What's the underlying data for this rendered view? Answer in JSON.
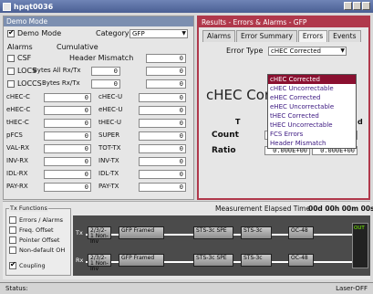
{
  "window": {
    "title": "hpqt0036"
  },
  "demo_panel": {
    "header": "Demo Mode",
    "demo_mode_label": "Demo Mode",
    "category_label": "Category",
    "category_value": "GFP",
    "alarms_label": "Alarms",
    "cumulative_label": "Cumulative",
    "alarm_rows": [
      {
        "label": "CSF",
        "desc": "Header Mismatch",
        "value": "0"
      },
      {
        "label": "LOCS",
        "desc": "Bytes All Rx/Tx",
        "value": "0",
        "value2": "0"
      },
      {
        "label": "LOCCS",
        "desc": "Bytes Rx/Tx",
        "value": "0",
        "value2": "0"
      }
    ],
    "counters_left": [
      {
        "label": "cHEC-C",
        "value": "0"
      },
      {
        "label": "eHEC-C",
        "value": "0"
      },
      {
        "label": "tHEC-C",
        "value": "0"
      },
      {
        "label": "pFCS",
        "value": "0"
      },
      {
        "label": "VAL-RX",
        "value": "0"
      },
      {
        "label": "INV-RX",
        "value": "0"
      },
      {
        "label": "IDL-RX",
        "value": "0"
      },
      {
        "label": "PAY-RX",
        "value": "0"
      }
    ],
    "counters_right": [
      {
        "label": "cHEC-U",
        "value": "0"
      },
      {
        "label": "eHEC-U",
        "value": "0"
      },
      {
        "label": "tHEC-U",
        "value": "0"
      },
      {
        "label": "SUPER",
        "value": "0"
      },
      {
        "label": "TOT-TX",
        "value": "0"
      },
      {
        "label": "INV-TX",
        "value": "0"
      },
      {
        "label": "IDL-TX",
        "value": "0"
      },
      {
        "label": "PAY-TX",
        "value": "0"
      }
    ]
  },
  "results_panel": {
    "header": "Results - Errors & Alarms - GFP",
    "tabs": [
      "Alarms",
      "Error Summary",
      "Errors",
      "Events"
    ],
    "error_type_label": "Error Type",
    "error_type_value": "cHEC Corrected",
    "big_title": "cHEC Cor",
    "column_hint_left": "T",
    "column_hint_right": "d",
    "count_label": "Count",
    "ratio_label": "Ratio",
    "ratio_value_1": "0.000E+00",
    "ratio_value_2": "0.000E+00",
    "dropdown_options": [
      "cHEC Corrected",
      "cHEC Uncorrectable",
      "eHEC Corrected",
      "eHEC Uncorrectable",
      "tHEC Corrected",
      "tHEC Uncorrectable",
      "FCS Errors",
      "Header Mismatch"
    ],
    "dropdown_selected_index": 0
  },
  "tx_functions": {
    "title": "Tx Functions",
    "items": [
      "Errors / Alarms",
      "Freq. Offset",
      "Pointer Offset",
      "Non-default OH"
    ],
    "coupling_label": "Coupling"
  },
  "diagram": {
    "elapsed_label": "Measurement Elapsed Time",
    "elapsed_value": "00d 00h 00m 00s",
    "tx_label": "Tx",
    "rx_label": "Rx",
    "tx_blocks": [
      "2/3/2-1 Non-Inv",
      "GFP Framed",
      "STS-3c SPE",
      "STS-3c",
      "OC-48"
    ],
    "rx_blocks": [
      "2/3/2-1 Non-Inv",
      "GFP Framed",
      "STS-3c SPE",
      "STS-3c",
      "OC-48"
    ],
    "port_label": "OUT"
  },
  "status": {
    "label": "Status:",
    "laser": "Laser-OFF"
  }
}
